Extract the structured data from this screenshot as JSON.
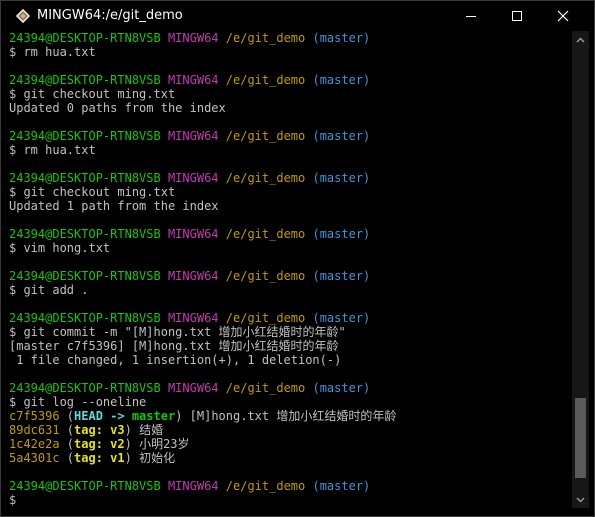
{
  "window": {
    "title": "MINGW64:/e/git_demo"
  },
  "prompt": {
    "user": "24394@DESKTOP-RTN8VSB",
    "host": "MINGW64",
    "path": "/e/git_demo",
    "branch": "(master)"
  },
  "lines": [
    {
      "type": "prompt"
    },
    {
      "type": "text",
      "text": "$ rm hua.txt"
    },
    {
      "type": "blank"
    },
    {
      "type": "prompt"
    },
    {
      "type": "text",
      "text": "$ git checkout ming.txt"
    },
    {
      "type": "text",
      "text": "Updated 0 paths from the index"
    },
    {
      "type": "blank"
    },
    {
      "type": "prompt"
    },
    {
      "type": "text",
      "text": "$ rm hua.txt"
    },
    {
      "type": "blank"
    },
    {
      "type": "prompt"
    },
    {
      "type": "text",
      "text": "$ git checkout ming.txt"
    },
    {
      "type": "text",
      "text": "Updated 1 path from the index"
    },
    {
      "type": "blank"
    },
    {
      "type": "prompt"
    },
    {
      "type": "text",
      "text": "$ vim hong.txt"
    },
    {
      "type": "blank"
    },
    {
      "type": "prompt"
    },
    {
      "type": "text",
      "text": "$ git add ."
    },
    {
      "type": "blank"
    },
    {
      "type": "prompt"
    },
    {
      "type": "text",
      "text": "$ git commit -m \"[M]hong.txt 增加小红结婚时的年龄\""
    },
    {
      "type": "text",
      "text": "[master c7f5396] [M]hong.txt 增加小红结婚时的年龄"
    },
    {
      "type": "text",
      "text": " 1 file changed, 1 insertion(+), 1 deletion(-)"
    },
    {
      "type": "blank"
    },
    {
      "type": "prompt"
    },
    {
      "type": "text",
      "text": "$ git log --oneline"
    },
    {
      "type": "log",
      "hash": "c7f5396",
      "ref_open": " (",
      "ref1": "HEAD -> ",
      "ref2": "master",
      "ref_close": ")",
      "msg": " [M]hong.txt 增加小红结婚时的年龄"
    },
    {
      "type": "log",
      "hash": "89dc631",
      "ref_open": " (",
      "ref1": "",
      "ref2": "tag: v3",
      "ref_close": ")",
      "msg": " 结婚"
    },
    {
      "type": "log",
      "hash": "1c42e2a",
      "ref_open": " (",
      "ref1": "",
      "ref2": "tag: v2",
      "ref_close": ")",
      "msg": " 小明23岁"
    },
    {
      "type": "log",
      "hash": "5a4301c",
      "ref_open": " (",
      "ref1": "",
      "ref2": "tag: v1",
      "ref_close": ")",
      "msg": " 初始化"
    },
    {
      "type": "blank"
    },
    {
      "type": "prompt"
    },
    {
      "type": "text",
      "text": "$"
    }
  ],
  "scrollbar": {
    "thumb_start": 0.79,
    "thumb_fraction": 0.18
  },
  "colors": {
    "user": "#16c60c",
    "host": "#c239b3",
    "path": "#c19c00",
    "branch": "#3a96dd",
    "head": "#61d6d6",
    "tag": "#e5e510"
  }
}
